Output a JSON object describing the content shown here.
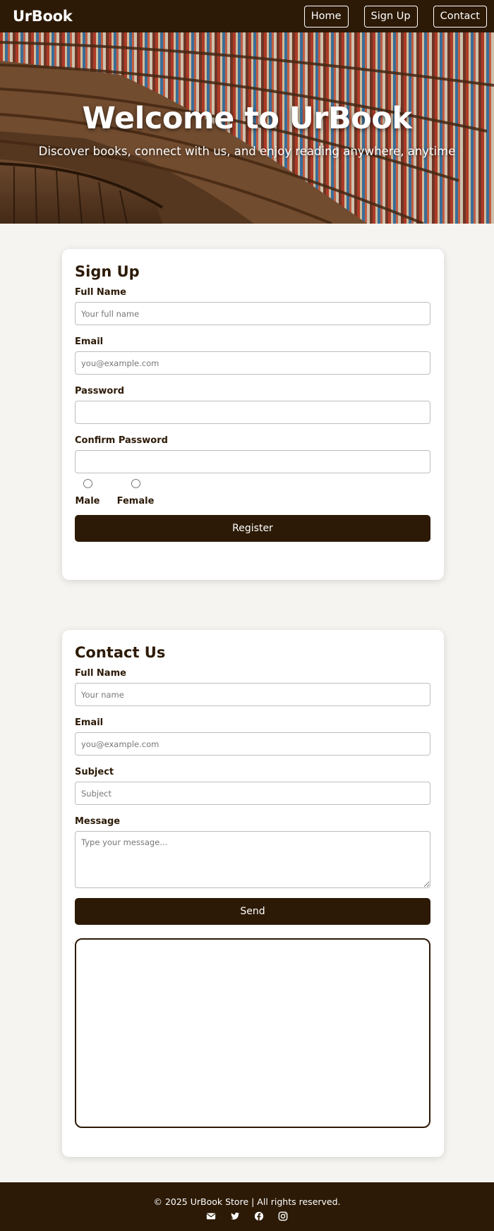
{
  "brand": "UrBook",
  "nav": {
    "home": "Home",
    "signup": "Sign Up",
    "contact": "Contact"
  },
  "hero": {
    "title": "Welcome to UrBook",
    "subtitle": "Discover books, connect with us, and enjoy reading anywhere, anytime"
  },
  "signup": {
    "heading": "Sign Up",
    "full_name_label": "Full Name",
    "full_name_placeholder": "Your full name",
    "email_label": "Email",
    "email_placeholder": "you@example.com",
    "password_label": "Password",
    "confirm_label": "Confirm Password",
    "male_label": "Male",
    "female_label": "Female",
    "register_label": "Register"
  },
  "contact": {
    "heading": "Contact Us",
    "name_label": "Full Name",
    "name_placeholder": "Your name",
    "email_label": "Email",
    "email_placeholder": "you@example.com",
    "subject_label": "Subject",
    "subject_placeholder": "Subject",
    "message_label": "Message",
    "message_placeholder": "Type your message...",
    "send_label": "Send"
  },
  "footer": {
    "text": "© 2025 UrBook Store | All rights reserved.",
    "icons": [
      "envelope-icon",
      "twitter-icon",
      "facebook-icon",
      "instagram-icon"
    ]
  },
  "colors": {
    "primary": "#2c1a06",
    "background": "#f6f4f0"
  }
}
